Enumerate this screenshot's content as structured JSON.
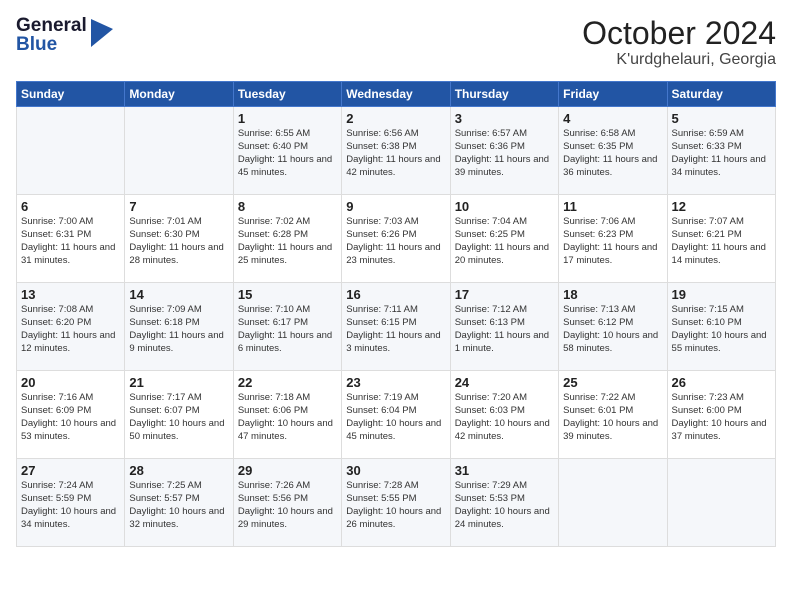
{
  "logo": {
    "general": "General",
    "blue": "Blue"
  },
  "title": "October 2024",
  "location": "K'urdghelauri, Georgia",
  "weekdays": [
    "Sunday",
    "Monday",
    "Tuesday",
    "Wednesday",
    "Thursday",
    "Friday",
    "Saturday"
  ],
  "weeks": [
    [
      {
        "day": "",
        "info": ""
      },
      {
        "day": "",
        "info": ""
      },
      {
        "day": "1",
        "info": "Sunrise: 6:55 AM\nSunset: 6:40 PM\nDaylight: 11 hours and 45 minutes."
      },
      {
        "day": "2",
        "info": "Sunrise: 6:56 AM\nSunset: 6:38 PM\nDaylight: 11 hours and 42 minutes."
      },
      {
        "day": "3",
        "info": "Sunrise: 6:57 AM\nSunset: 6:36 PM\nDaylight: 11 hours and 39 minutes."
      },
      {
        "day": "4",
        "info": "Sunrise: 6:58 AM\nSunset: 6:35 PM\nDaylight: 11 hours and 36 minutes."
      },
      {
        "day": "5",
        "info": "Sunrise: 6:59 AM\nSunset: 6:33 PM\nDaylight: 11 hours and 34 minutes."
      }
    ],
    [
      {
        "day": "6",
        "info": "Sunrise: 7:00 AM\nSunset: 6:31 PM\nDaylight: 11 hours and 31 minutes."
      },
      {
        "day": "7",
        "info": "Sunrise: 7:01 AM\nSunset: 6:30 PM\nDaylight: 11 hours and 28 minutes."
      },
      {
        "day": "8",
        "info": "Sunrise: 7:02 AM\nSunset: 6:28 PM\nDaylight: 11 hours and 25 minutes."
      },
      {
        "day": "9",
        "info": "Sunrise: 7:03 AM\nSunset: 6:26 PM\nDaylight: 11 hours and 23 minutes."
      },
      {
        "day": "10",
        "info": "Sunrise: 7:04 AM\nSunset: 6:25 PM\nDaylight: 11 hours and 20 minutes."
      },
      {
        "day": "11",
        "info": "Sunrise: 7:06 AM\nSunset: 6:23 PM\nDaylight: 11 hours and 17 minutes."
      },
      {
        "day": "12",
        "info": "Sunrise: 7:07 AM\nSunset: 6:21 PM\nDaylight: 11 hours and 14 minutes."
      }
    ],
    [
      {
        "day": "13",
        "info": "Sunrise: 7:08 AM\nSunset: 6:20 PM\nDaylight: 11 hours and 12 minutes."
      },
      {
        "day": "14",
        "info": "Sunrise: 7:09 AM\nSunset: 6:18 PM\nDaylight: 11 hours and 9 minutes."
      },
      {
        "day": "15",
        "info": "Sunrise: 7:10 AM\nSunset: 6:17 PM\nDaylight: 11 hours and 6 minutes."
      },
      {
        "day": "16",
        "info": "Sunrise: 7:11 AM\nSunset: 6:15 PM\nDaylight: 11 hours and 3 minutes."
      },
      {
        "day": "17",
        "info": "Sunrise: 7:12 AM\nSunset: 6:13 PM\nDaylight: 11 hours and 1 minute."
      },
      {
        "day": "18",
        "info": "Sunrise: 7:13 AM\nSunset: 6:12 PM\nDaylight: 10 hours and 58 minutes."
      },
      {
        "day": "19",
        "info": "Sunrise: 7:15 AM\nSunset: 6:10 PM\nDaylight: 10 hours and 55 minutes."
      }
    ],
    [
      {
        "day": "20",
        "info": "Sunrise: 7:16 AM\nSunset: 6:09 PM\nDaylight: 10 hours and 53 minutes."
      },
      {
        "day": "21",
        "info": "Sunrise: 7:17 AM\nSunset: 6:07 PM\nDaylight: 10 hours and 50 minutes."
      },
      {
        "day": "22",
        "info": "Sunrise: 7:18 AM\nSunset: 6:06 PM\nDaylight: 10 hours and 47 minutes."
      },
      {
        "day": "23",
        "info": "Sunrise: 7:19 AM\nSunset: 6:04 PM\nDaylight: 10 hours and 45 minutes."
      },
      {
        "day": "24",
        "info": "Sunrise: 7:20 AM\nSunset: 6:03 PM\nDaylight: 10 hours and 42 minutes."
      },
      {
        "day": "25",
        "info": "Sunrise: 7:22 AM\nSunset: 6:01 PM\nDaylight: 10 hours and 39 minutes."
      },
      {
        "day": "26",
        "info": "Sunrise: 7:23 AM\nSunset: 6:00 PM\nDaylight: 10 hours and 37 minutes."
      }
    ],
    [
      {
        "day": "27",
        "info": "Sunrise: 7:24 AM\nSunset: 5:59 PM\nDaylight: 10 hours and 34 minutes."
      },
      {
        "day": "28",
        "info": "Sunrise: 7:25 AM\nSunset: 5:57 PM\nDaylight: 10 hours and 32 minutes."
      },
      {
        "day": "29",
        "info": "Sunrise: 7:26 AM\nSunset: 5:56 PM\nDaylight: 10 hours and 29 minutes."
      },
      {
        "day": "30",
        "info": "Sunrise: 7:28 AM\nSunset: 5:55 PM\nDaylight: 10 hours and 26 minutes."
      },
      {
        "day": "31",
        "info": "Sunrise: 7:29 AM\nSunset: 5:53 PM\nDaylight: 10 hours and 24 minutes."
      },
      {
        "day": "",
        "info": ""
      },
      {
        "day": "",
        "info": ""
      }
    ]
  ]
}
